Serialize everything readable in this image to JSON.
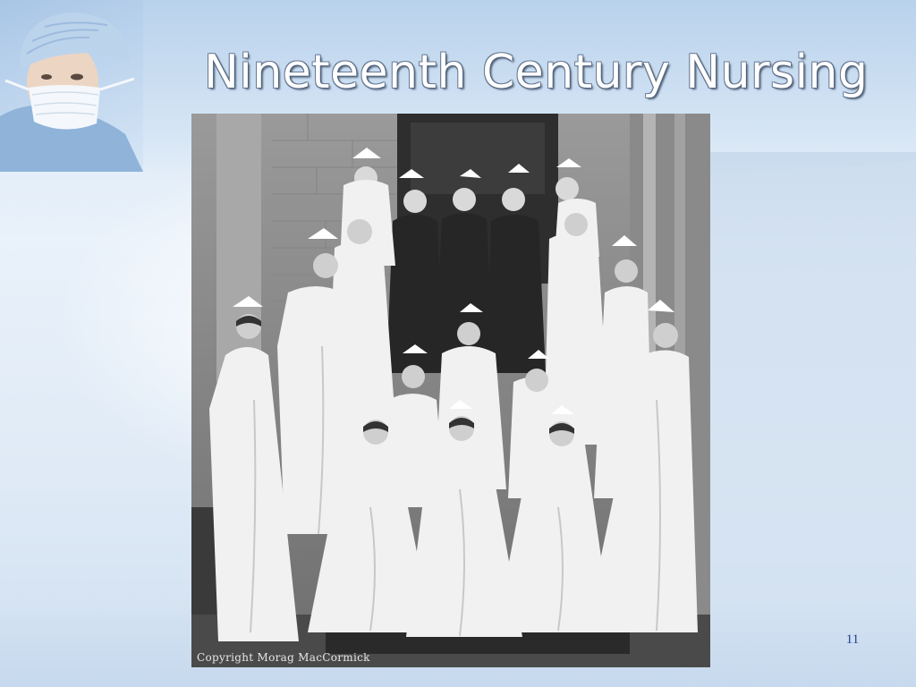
{
  "slide": {
    "title": "Nineteenth Century Nursing",
    "photo": {
      "caption": "Copyright Morag MacCormick"
    },
    "page_number": "11"
  },
  "colors": {
    "title_text": "#ffffff",
    "page_number": "#23408e",
    "background": "#dfeaf6"
  },
  "icons": {
    "corner_art": "surgeon-icon",
    "photo": "nurses-group-photo-icon"
  }
}
